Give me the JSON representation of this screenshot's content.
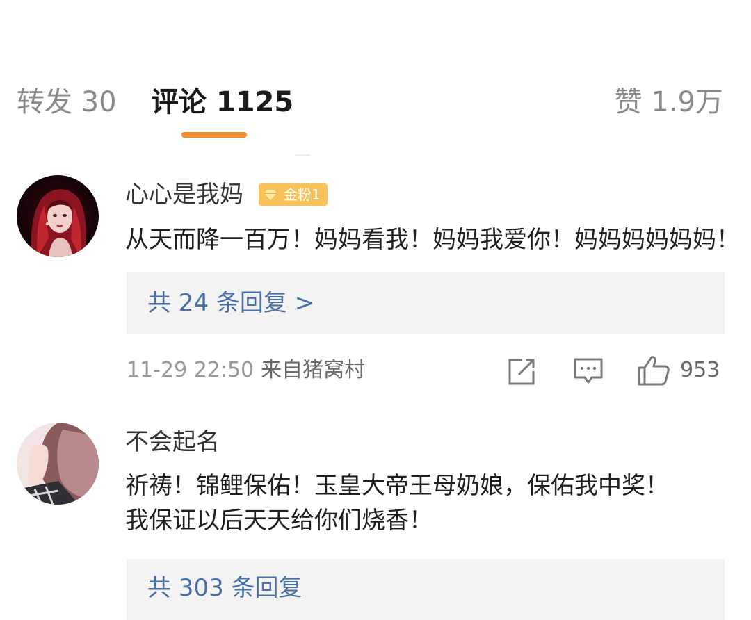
{
  "tabs": {
    "repost": "转发 30",
    "comment": "评论 1125",
    "like": "赞 1.9万"
  },
  "comments": [
    {
      "username": "心心是我妈",
      "badge": "金粉1",
      "text_lines": [
        "从天而降一百万！妈妈看我！妈妈我爱你！妈妈妈妈妈妈！"
      ],
      "reply_link": "共 24 条回复 >",
      "time": "11-29 22:50",
      "source": "来自猪窝村",
      "like_count": "953"
    },
    {
      "username": "不会起名",
      "text_lines": [
        "祈祷！锦鲤保佑！玉皇大帝王母奶娘，保佑我中奖！",
        "我保证以后天天给你们烧香！"
      ],
      "reply_link": "共 303 条回复"
    }
  ],
  "icons": {
    "share": "share-icon",
    "reply": "comment-icon",
    "like": "thumbs-up-icon",
    "badge": "diamond-icon"
  },
  "colors": {
    "accent": "#f08a2b",
    "link": "#4a6fa5",
    "badge": "#f7c25a"
  }
}
